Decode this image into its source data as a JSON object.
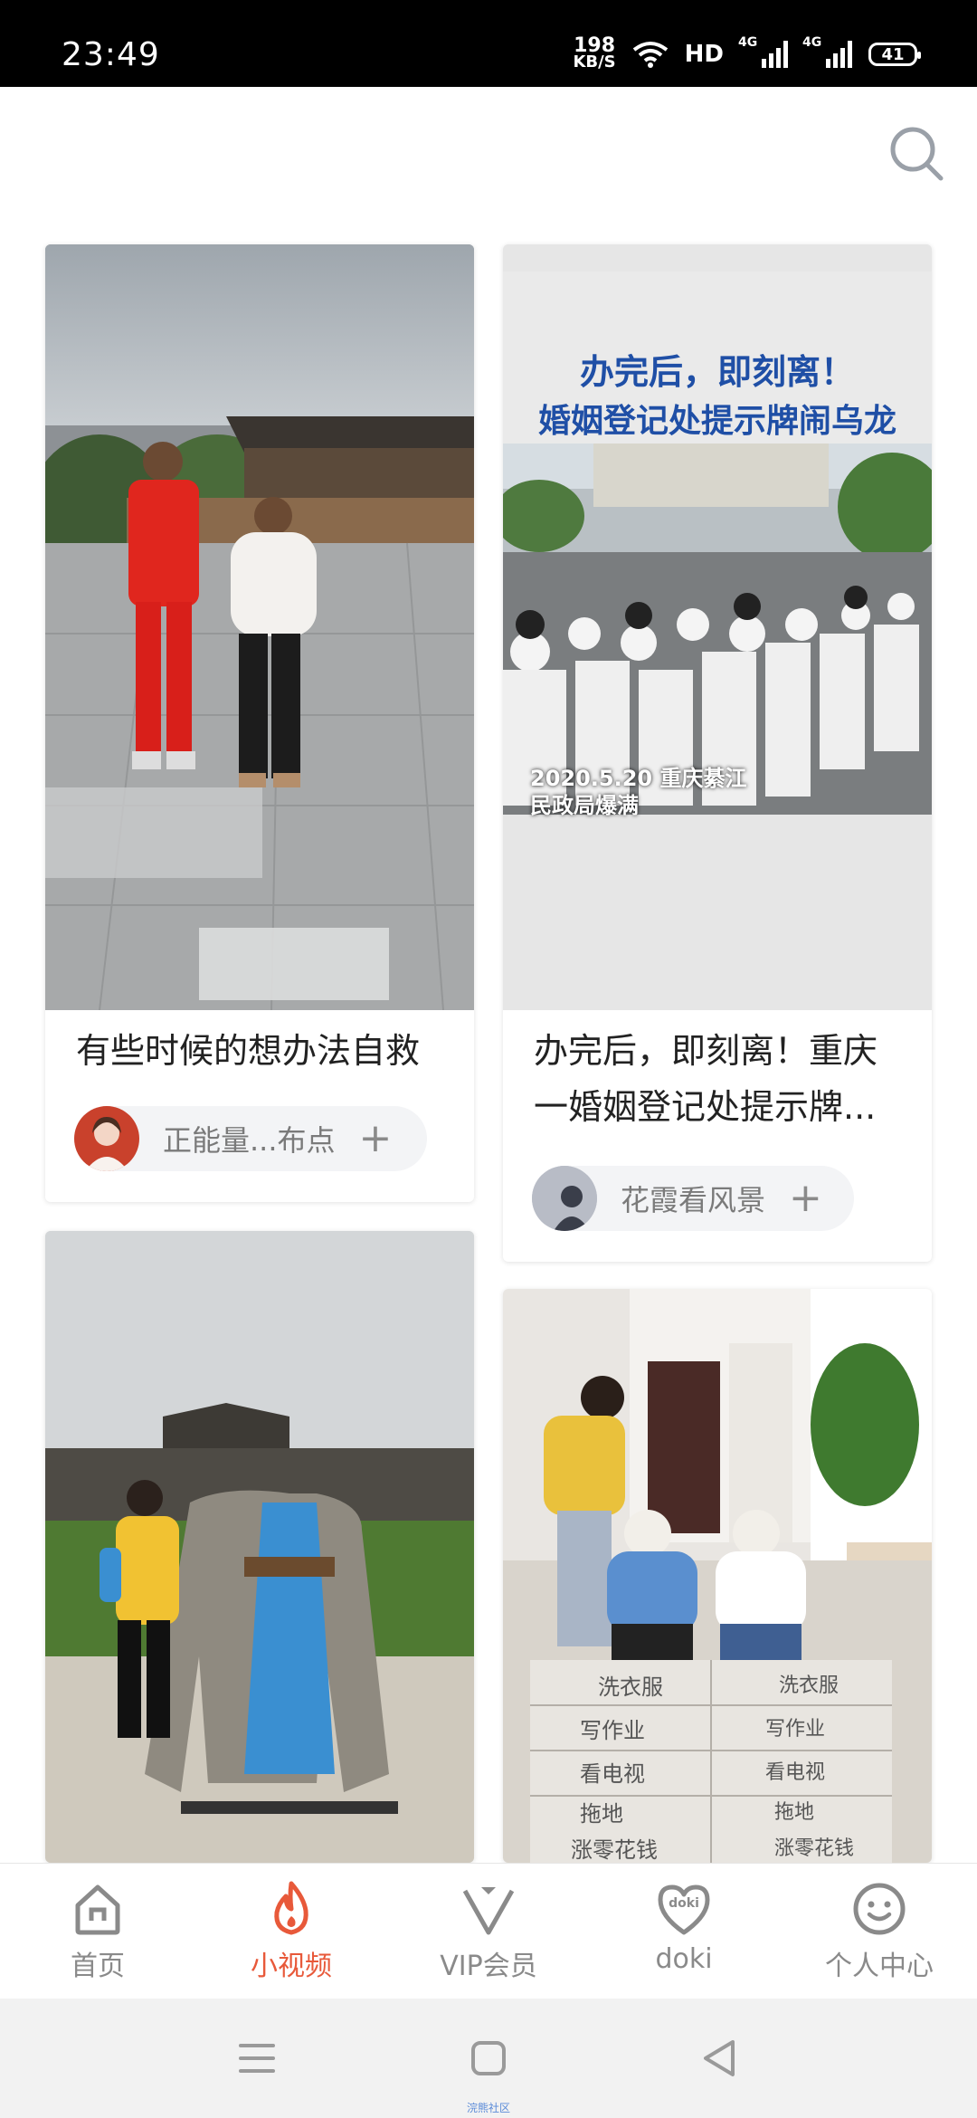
{
  "status_bar": {
    "time": "23:49",
    "net_speed_value": "198",
    "net_speed_unit": "KB/S",
    "hd_label": "HD",
    "signal1_label": "4G",
    "signal2_label": "4G",
    "battery": "41"
  },
  "feed": {
    "cards": [
      {
        "title": "有些时候的想办法自救",
        "author": "正能量...布点",
        "follow_label": "+"
      },
      {
        "title": "办完后，即刻离！重庆一婚姻登记处提示牌...",
        "title_line1": "办完后，即刻离！重庆",
        "title_line2": "一婚姻登记处提示牌...",
        "author": "花霞看风景",
        "follow_label": "+",
        "overlay_line1": "办完后，即刻离！",
        "overlay_line2": "婚姻登记处提示牌闹乌龙",
        "overlay_caption1": "2020.5.20 重庆綦江",
        "overlay_caption2": "民政局爆满"
      },
      {
        "title": ""
      },
      {
        "title": "",
        "floor_words": [
          "洗衣服",
          "写作业",
          "看电视",
          "拖地",
          "涨零花钱",
          "洗衣服",
          "写作业",
          "看电视",
          "拖地",
          "涨零花钱"
        ]
      }
    ]
  },
  "tabbar": {
    "tabs": [
      {
        "label": "首页",
        "icon": "home-icon"
      },
      {
        "label": "小视频",
        "icon": "flame-icon",
        "active": true
      },
      {
        "label": "VIP会员",
        "icon": "vip-icon"
      },
      {
        "label": "doki",
        "icon": "doki-heart-icon"
      },
      {
        "label": "个人中心",
        "icon": "smiley-icon"
      }
    ],
    "doki_badge": "doki"
  },
  "nav": {
    "hint": "浣熊社区"
  },
  "colors": {
    "accent": "#e8593a",
    "inactive": "#8a8a8a"
  }
}
